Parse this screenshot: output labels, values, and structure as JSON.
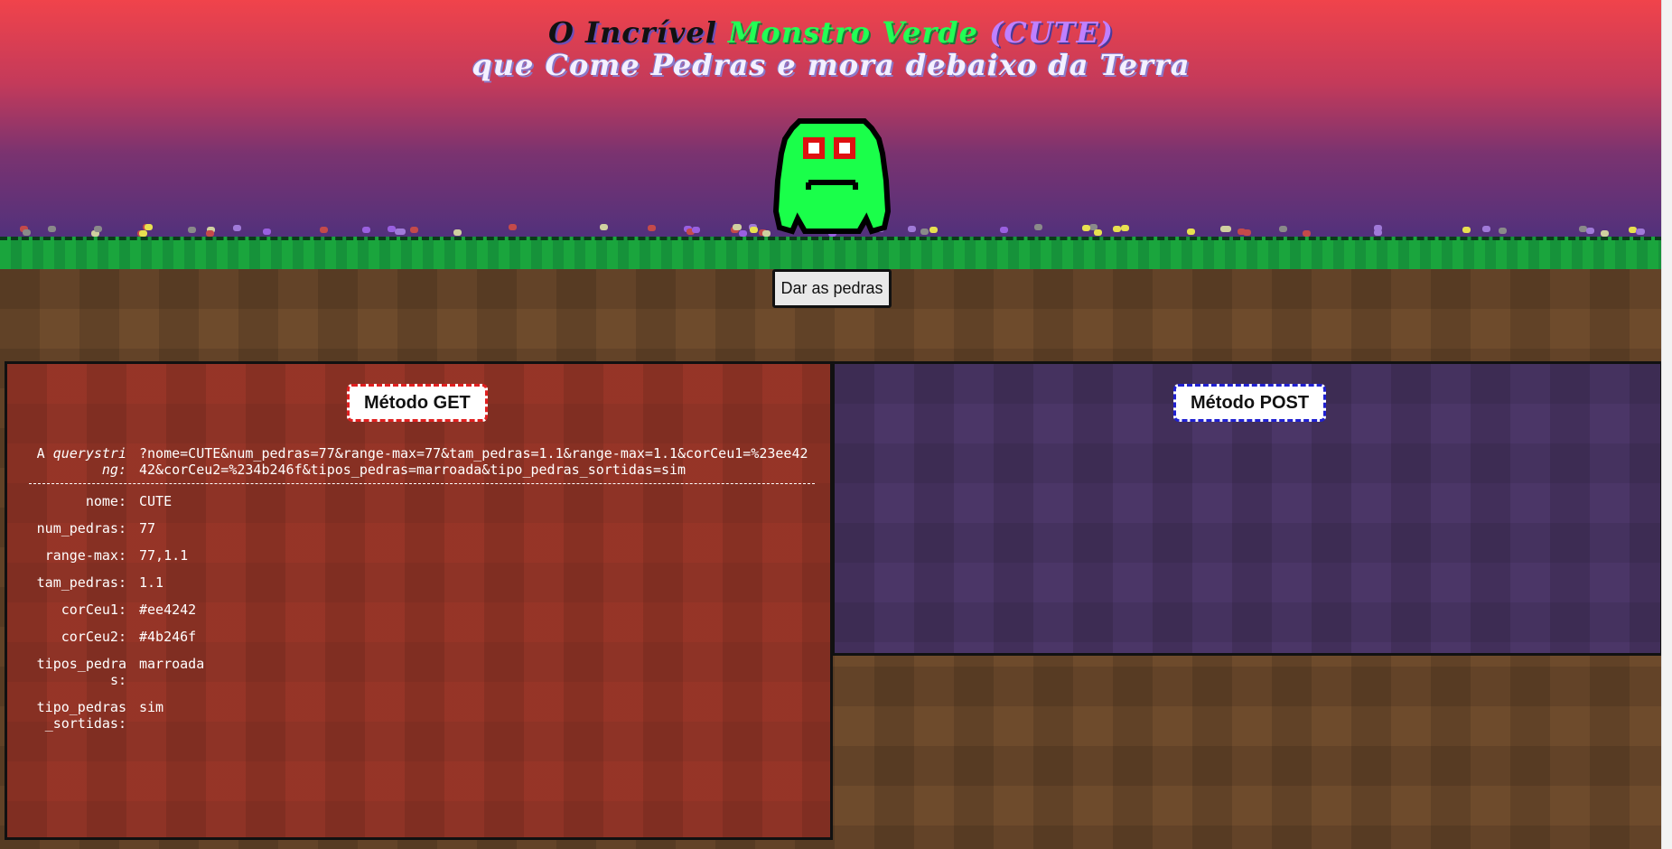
{
  "title": {
    "part1": "O Incrível",
    "part2": "Monstro Verde",
    "part3": "(CUTE)",
    "line2": "que Come Pedras e mora debaixo da Terra"
  },
  "button": {
    "label": "Dar as pedras"
  },
  "get_panel": {
    "title": "Método GET",
    "querystring_label_a": "A",
    "querystring_label_b": "querystring:",
    "querystring": "?nome=CUTE&num_pedras=77&range-max=77&tam_pedras=1.1&range-max=1.1&corCeu1=%23ee4242&corCeu2=%234b246f&tipos_pedras=marroada&tipo_pedras_sortidas=sim",
    "params": [
      {
        "key": "nome:",
        "value": "CUTE"
      },
      {
        "key": "num_pedras:",
        "value": "77"
      },
      {
        "key": "range-max:",
        "value": "77,1.1"
      },
      {
        "key": "tam_pedras:",
        "value": "1.1"
      },
      {
        "key": "corCeu1:",
        "value": "#ee4242"
      },
      {
        "key": "corCeu2:",
        "value": "#4b246f"
      },
      {
        "key": "tipos_pedras:",
        "value": "marroada"
      },
      {
        "key": "tipo_pedras_sortidas:",
        "value": "sim"
      }
    ]
  },
  "post_panel": {
    "title": "Método POST"
  },
  "colors": {
    "sky_top": "#ee4242",
    "sky_bottom": "#4b246f",
    "monster": "#1aff4a",
    "grass": "#1aa53d"
  }
}
